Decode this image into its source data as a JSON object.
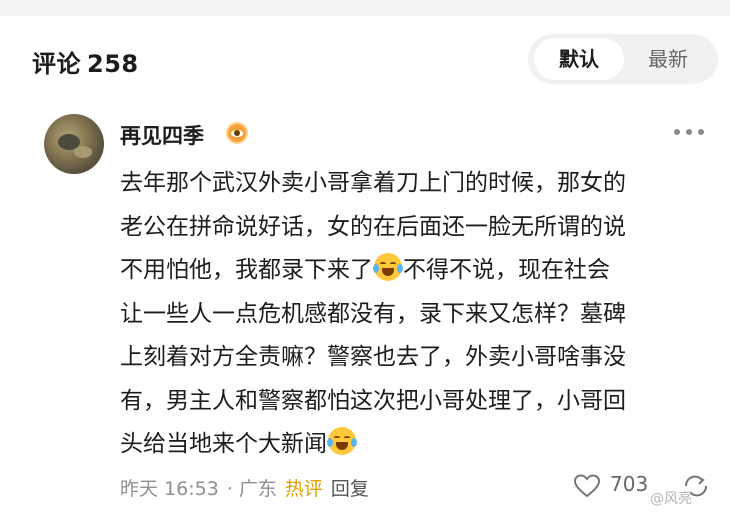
{
  "header": {
    "title": "评论",
    "count": "258",
    "sort_options": [
      "默认",
      "最新"
    ]
  },
  "comment": {
    "username": "再见四季",
    "lines": [
      "去年那个武汉外卖小哥拿着刀上门的时候，那女的",
      "老公在拼命说好话，女的在后面还一脸无所谓的说",
      "不用怕他，我都录下来了",
      "不得不说，现在社会",
      "让一些人一点危机感都没有，录下来又怎样？墓碑",
      "上刻着对方全责嘛？警察也去了，外卖小哥啥事没",
      "有，男主人和警察都怕这次把小哥处理了，小哥回",
      "头给当地来个大新闻"
    ],
    "time": "昨天 16:53",
    "location": "· 广东",
    "hot_label": "热评",
    "reply_label": "回复",
    "likes": "703"
  },
  "watermark": "@风亮",
  "colors": {
    "hot": "#d9a300",
    "badge": "#f6a23b",
    "emoji": "#ffc83a"
  },
  "icons": [
    "fan-badge-icon",
    "more-icon",
    "laughing-crying-emoji",
    "heart-icon",
    "share-icon"
  ]
}
